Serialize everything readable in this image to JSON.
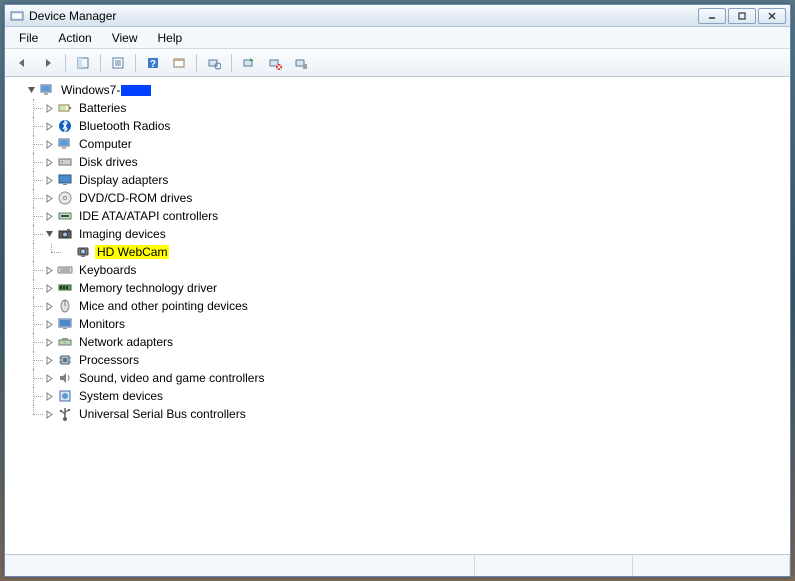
{
  "window": {
    "title": "Device Manager"
  },
  "menu": {
    "file": "File",
    "action": "Action",
    "view": "View",
    "help": "Help"
  },
  "tree": {
    "root": "Windows7-",
    "categories": [
      {
        "label": "Batteries",
        "icon": "battery"
      },
      {
        "label": "Bluetooth Radios",
        "icon": "bluetooth"
      },
      {
        "label": "Computer",
        "icon": "computer"
      },
      {
        "label": "Disk drives",
        "icon": "disk"
      },
      {
        "label": "Display adapters",
        "icon": "display"
      },
      {
        "label": "DVD/CD-ROM drives",
        "icon": "cdrom"
      },
      {
        "label": "IDE ATA/ATAPI controllers",
        "icon": "ide"
      },
      {
        "label": "Imaging devices",
        "icon": "camera",
        "expanded": true,
        "children": [
          {
            "label": "HD WebCam",
            "icon": "webcam",
            "highlighted": true
          }
        ]
      },
      {
        "label": "Keyboards",
        "icon": "keyboard"
      },
      {
        "label": "Memory technology driver",
        "icon": "memory"
      },
      {
        "label": "Mice and other pointing devices",
        "icon": "mouse"
      },
      {
        "label": "Monitors",
        "icon": "monitor"
      },
      {
        "label": "Network adapters",
        "icon": "network"
      },
      {
        "label": "Processors",
        "icon": "cpu"
      },
      {
        "label": "Sound, video and game controllers",
        "icon": "sound"
      },
      {
        "label": "System devices",
        "icon": "system"
      },
      {
        "label": "Universal Serial Bus controllers",
        "icon": "usb"
      }
    ]
  }
}
